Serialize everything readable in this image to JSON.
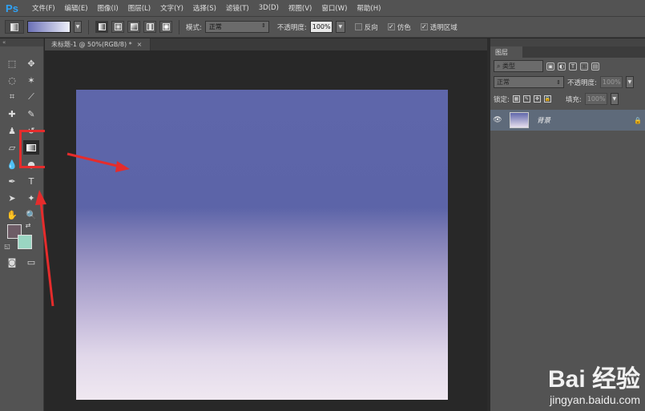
{
  "app": {
    "logo": "Ps"
  },
  "menu": [
    "文件(F)",
    "编辑(E)",
    "图像(I)",
    "图层(L)",
    "文字(Y)",
    "选择(S)",
    "滤镜(T)",
    "3D(D)",
    "视图(V)",
    "窗口(W)",
    "帮助(H)"
  ],
  "options": {
    "mode_label": "模式:",
    "mode_value": "正常",
    "opacity_label": "不透明度:",
    "opacity_value": "100%",
    "reverse_label": "反向",
    "dither_label": "仿色",
    "transparency_label": "透明区域",
    "dither_checked": "✓",
    "transparency_checked": "✓"
  },
  "document": {
    "tab_title": "未标题-1 @ 50%(RGB/8) *",
    "close": "×"
  },
  "gradient": {
    "start_color": "#5e66aa",
    "end_color": "#f0e8f1"
  },
  "colors": {
    "foreground": "#6e5c66",
    "background": "#9ad5c2",
    "highlight": "#e52c2c"
  },
  "layers_panel": {
    "tab": "图层",
    "filter_kind": "类型",
    "blend_mode": "正常",
    "opacity_label": "不透明度:",
    "opacity_value": "100%",
    "lock_label": "锁定:",
    "fill_label": "填充:",
    "fill_value": "100%",
    "layers": [
      {
        "name": "背景",
        "visible": "👁"
      }
    ]
  },
  "watermark": {
    "logo": "Bai 经验",
    "url": "jingyan.baidu.com"
  }
}
